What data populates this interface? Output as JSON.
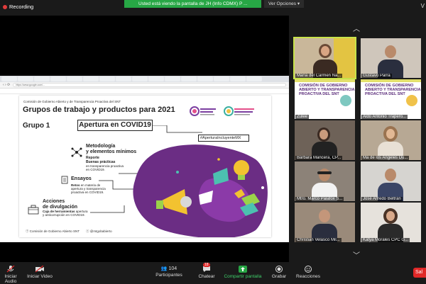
{
  "topbar": {
    "recording_label": "Recording",
    "share_banner": "Usted está viendo la pantalla de JH (Info CDMX) P ...",
    "options_label": "Ver Opciones",
    "view_label": "V"
  },
  "browser": {
    "url": "https://www.google.com/..."
  },
  "slide": {
    "header": "Comisión de Gobierno Abierto y de Transparencia Proactiva del SNT",
    "title": "Grupos de trabajo y productos para 2021",
    "group": "Grupo 1",
    "covid_box": "Apertura en COVID19",
    "hashtag": "#AperturaIncluyenteMX",
    "metodologia_title_1": "Metodología",
    "metodologia_title_2": "y elementos mínimos",
    "reporte_title": "Reporte",
    "reporte_sub": "Buenas prácticas",
    "reporte_text_1": "en transparencia proactiva",
    "reporte_text_2": "en COVID19.",
    "ensayos_title": "Ensayos",
    "retos_bold": "Retos",
    "retos_text_1": " en materia de",
    "retos_text_2": "apertura y transparencia",
    "retos_text_3": "proactiva en COVID19.",
    "acciones_title_1": "Acciones",
    "acciones_title_2": "de divulgación",
    "caja_text_1": "Caja de herramientas",
    "caja_text_2": " apertura",
    "caja_text_3": "y anticorrupción en COVID19.",
    "footer_left": "Comisión de Gobierno Abierto SNT",
    "footer_right": "@mtgobabierto"
  },
  "gallery": {
    "tiles": [
      {
        "name": "María del Carmen Na..."
      },
      {
        "name": "Gustavo Parra"
      },
      {
        "name": "Zulee"
      },
      {
        "name": "Aldo Antonio Trapero..."
      },
      {
        "name": "Bárbara Mancera, CP..."
      },
      {
        "name": "Ma de los Angeles Du..."
      },
      {
        "name": "Mtro. Marco Palafox S..."
      },
      {
        "name": "José Alfredo Beltrán"
      },
      {
        "name": "Christian Velasco Mil..."
      },
      {
        "name": "Katya Morales CPC G..."
      }
    ],
    "slide_tile_title_1": "COMISIÓN DE GOBIERNO",
    "slide_tile_title_2": "ABIERTO Y TRANSPARENCIA",
    "slide_tile_title_3": "PROACTIVA DEL SNT"
  },
  "bottombar": {
    "audio_label": "Iniciar Audio",
    "video_label": "Iniciar Video",
    "participants_count": "104",
    "participants_label": "Participantes",
    "chat_badge": "18",
    "chat_label": "Chatear",
    "share_label": "Compartir pantalla",
    "record_label": "Grabar",
    "reactions_label": "Reacciones",
    "end_label": "Sal"
  }
}
